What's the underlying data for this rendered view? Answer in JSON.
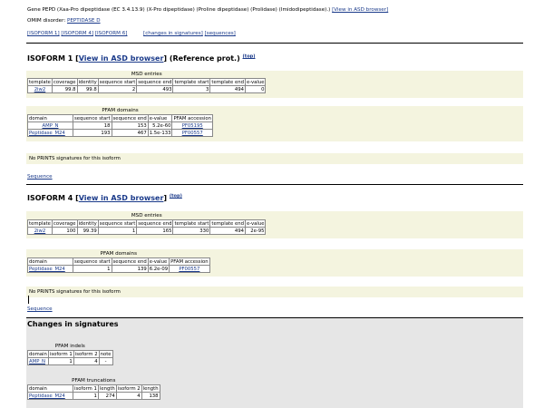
{
  "header": {
    "gene_line": "Gene PEPD (Xaa-Pro dipeptidase (EC 3.4.13.9) (X-Pro dipeptidase) (Proline dipeptidase) (Prolidase) (Imidodipeptidase).)",
    "gene_link": "[View in ASD browser]",
    "omim_label": "OMIM disorder:",
    "omim_link": "PEPTIDASE D"
  },
  "nav": {
    "iso1": "[ISOFORM 1]",
    "iso4": "[ISOFORM 4]",
    "iso6": "[ISOFORM 6]",
    "changes": "[changes in signatures]",
    "sequences": "[sequences]"
  },
  "isoform1": {
    "title": "ISOFORM 1",
    "open": "[",
    "link": "View in ASD browser",
    "close": "] (Reference prot.)",
    "top": "(top)",
    "msd": {
      "caption": "MSD entries",
      "headers": [
        "template",
        "coverage",
        "identity",
        "sequence start",
        "sequence end",
        "template start",
        "template end",
        "e-value"
      ],
      "rows": [
        [
          "2iw2",
          "99.8",
          "99.8",
          "2",
          "493",
          "3",
          "494",
          "0"
        ]
      ]
    },
    "pfam": {
      "caption": "PFAM domains",
      "headers": [
        "domain",
        "sequence start",
        "sequence end",
        "e-value",
        "PFAM accession"
      ],
      "rows": [
        [
          "AMP_N",
          "18",
          "153",
          "5.2e-60",
          "PF05195"
        ],
        [
          "Peptidase_M24",
          "193",
          "467",
          "1.5e-133",
          "PF00557"
        ]
      ]
    },
    "noprints": "No PRINTS signatures for this isoform",
    "sequence": "Sequence"
  },
  "isoform4": {
    "title": "ISOFORM 4",
    "open": "[",
    "link": "View in ASD browser",
    "close": "]",
    "top": "(top)",
    "msd": {
      "caption": "MSD entries",
      "headers": [
        "template",
        "coverage",
        "identity",
        "sequence start",
        "sequence end",
        "template start",
        "template end",
        "e-value"
      ],
      "rows": [
        [
          "2iw2",
          "100",
          "99.39",
          "1",
          "165",
          "330",
          "494",
          "2e-95"
        ]
      ]
    },
    "pfam": {
      "caption": "PFAM domains",
      "headers": [
        "domain",
        "sequence start",
        "sequence end",
        "e-value",
        "PFAM accession"
      ],
      "rows": [
        [
          "Peptidase_M24",
          "1",
          "139",
          "6.2e-09",
          "PF00557"
        ]
      ]
    },
    "noprints": "No PRINTS signatures for this isoform",
    "sequence": "Sequence"
  },
  "changes": {
    "title": "Changes in signatures",
    "indels": {
      "caption": "PFAM indels",
      "headers": [
        "domain",
        "isoform 1",
        "isoform 2",
        "note"
      ],
      "rows": [
        [
          "AMP_N",
          "1",
          "4",
          "-"
        ]
      ]
    },
    "truncations": {
      "caption": "PFAM truncations",
      "headers": [
        "domain",
        "isoform 1",
        "length",
        "isoform 2",
        "length"
      ],
      "rows": [
        [
          "Peptidase_M24",
          "1",
          "274",
          "4",
          "138"
        ]
      ]
    }
  }
}
